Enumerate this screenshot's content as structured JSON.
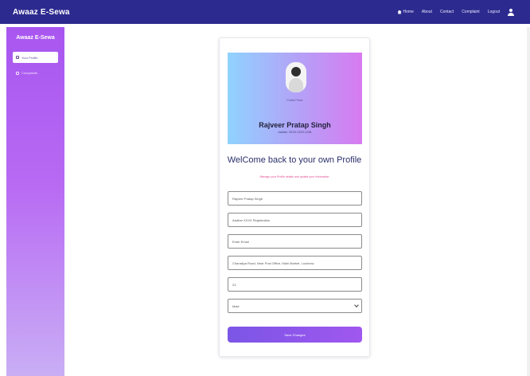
{
  "app": {
    "brand": "Awaaz E-Sewa"
  },
  "topnav": {
    "items": [
      "Home",
      "About",
      "Contact",
      "Complaint",
      "Logout"
    ]
  },
  "sidebar": {
    "title": "Awaaz E-Sewa",
    "active_item": "Your Profile",
    "items": [
      {
        "label": "Complaints"
      }
    ]
  },
  "profile": {
    "banner_caption": "Profile Photo",
    "name": "Rajveer Pratap Singh",
    "id_text": "Aadhar: XXXX-XXXX-1234"
  },
  "form": {
    "heading": "WelCome back to your own Profile",
    "subtitle": "Manage your Profile details and update your information",
    "fields": [
      {
        "value": "Rajveer Pratap Singh"
      },
      {
        "value": "Aadhar XXXX Registration"
      },
      {
        "value": "Enter Email"
      },
      {
        "value": "Chanakya Road, Near Post Office, Main Market, Lucknow"
      },
      {
        "value": "23"
      },
      {
        "value": "Male"
      }
    ],
    "submit_label": "Save Changes"
  },
  "colors": {
    "navbar": "#2d2a8f",
    "sidebar": "#a856f0",
    "accent": "#7b56e6",
    "subtitle": "#e14c93"
  },
  "icons": [
    "home-icon",
    "user-icon",
    "profile-icon",
    "complaint-icon",
    "chevron-down-icon"
  ]
}
